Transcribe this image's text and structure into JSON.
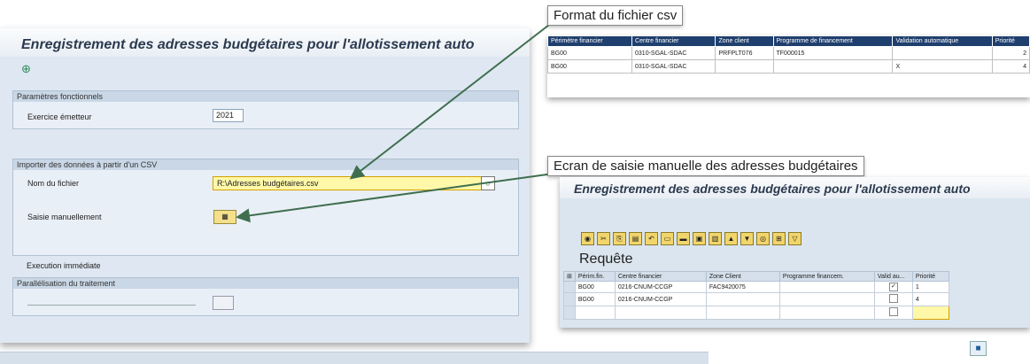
{
  "main": {
    "title": "Enregistrement des adresses budgétaires pour l'allotissement auto",
    "section_params": "Paramètres fonctionnels",
    "exercice_label": "Exercice émetteur",
    "exercice_value": "2021",
    "section_import": "Importer des données à partir d'un CSV",
    "file_label": "Nom du fichier",
    "file_value": "R:\\Adresses budgétaires.csv",
    "manual_label": "Saisie manuellement",
    "exec_label": "Execution immédiate",
    "section_parallel": "Parallélisation du traitement"
  },
  "csv_callout": {
    "title": "Format du fichier csv",
    "headers": [
      "Périmètre financier",
      "Centre financier",
      "Zone client",
      "Programme de financement",
      "Validation automatique",
      "Priorité"
    ],
    "rows": [
      [
        "BG00",
        "0310-SGAL-SDAC",
        "PRFPLT076",
        "TF000015",
        "",
        "2"
      ],
      [
        "BG00",
        "0310-SGAL-SDAC",
        "",
        "",
        "X",
        "4"
      ]
    ]
  },
  "manual_callout": {
    "title": "Ecran de saisie manuelle des adresses budgétaires",
    "window_title": "Enregistrement des adresses budgétaires pour l'allotissement auto",
    "requete_label": "Requête",
    "headers": [
      "Périm.fin.",
      "Centre financier",
      "Zone Client",
      "Programme financem.",
      "Valid au...",
      "Priorité"
    ],
    "rows": [
      [
        "BG00",
        "0216-CNUM-CCGP",
        "FAC9420075",
        "",
        "checked",
        "1"
      ],
      [
        "BG00",
        "0216-CNUM-CCGP",
        "",
        "",
        "",
        "4"
      ],
      [
        "",
        "",
        "",
        "",
        "",
        ""
      ]
    ]
  },
  "colors": {
    "arrow": "#3f6e4f",
    "csv_header_bg": "#1f3f6e",
    "file_field_bg": "#fff8a8"
  }
}
